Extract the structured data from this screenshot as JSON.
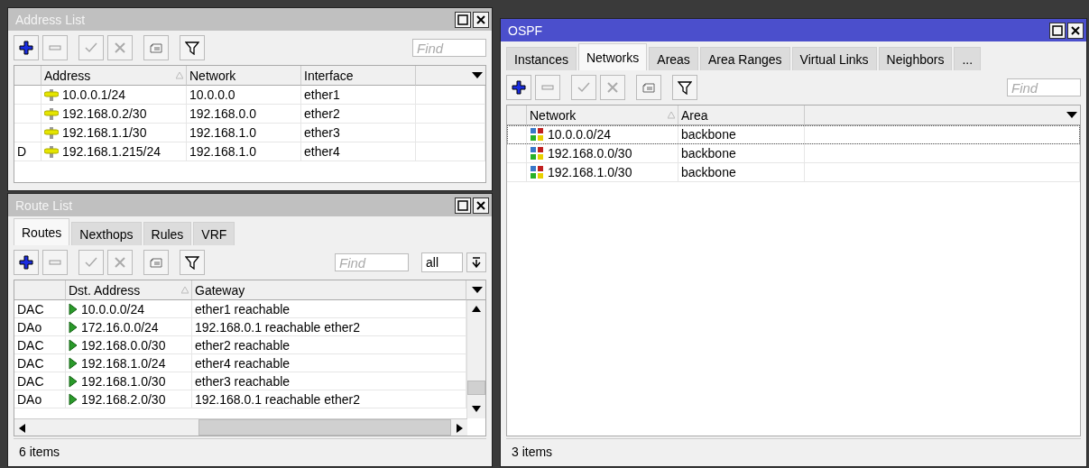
{
  "windows": [
    {
      "kind": "address_list",
      "title": "Address List",
      "active": false,
      "toolbar": {
        "find_placeholder": "Find"
      },
      "table": {
        "columns": [
          {
            "label": "Address",
            "sorted": true
          },
          {
            "label": "Network",
            "sorted": false
          },
          {
            "label": "Interface",
            "sorted": false
          }
        ],
        "rows": [
          {
            "cells": [
              "10.0.0.1/24",
              "10.0.0.0",
              "ether1"
            ]
          },
          {
            "cells": [
              "192.168.0.2/30",
              "192.168.0.0",
              "ether2"
            ]
          },
          {
            "cells": [
              "192.168.1.1/30",
              "192.168.1.0",
              "ether3"
            ]
          },
          {
            "flag": "D",
            "cells": [
              "192.168.1.215/24",
              "192.168.1.0",
              "ether4"
            ]
          }
        ]
      }
    },
    {
      "kind": "route_list",
      "title": "Route List",
      "active": false,
      "tabs": [
        {
          "label": "Routes",
          "selected": true
        },
        {
          "label": "Nexthops",
          "selected": false
        },
        {
          "label": "Rules",
          "selected": false
        },
        {
          "label": "VRF",
          "selected": false
        }
      ],
      "toolbar": {
        "find_placeholder": "Find",
        "filter_value": "all"
      },
      "table": {
        "columns": [
          {
            "label": "Dst. Address",
            "sorted": true
          },
          {
            "label": "Gateway",
            "sorted": false
          }
        ],
        "rows": [
          {
            "flag": "DAC",
            "cells": [
              "10.0.0.0/24",
              "ether1 reachable"
            ]
          },
          {
            "flag": "DAo",
            "cells": [
              "172.16.0.0/24",
              "192.168.0.1 reachable ether2"
            ]
          },
          {
            "flag": "DAC",
            "cells": [
              "192.168.0.0/30",
              "ether2 reachable"
            ]
          },
          {
            "flag": "DAC",
            "cells": [
              "192.168.1.0/24",
              "ether4 reachable"
            ]
          },
          {
            "flag": "DAC",
            "cells": [
              "192.168.1.0/30",
              "ether3 reachable"
            ]
          },
          {
            "flag": "DAo",
            "cells": [
              "192.168.2.0/30",
              "192.168.0.1 reachable ether2"
            ]
          }
        ]
      },
      "status": "6 items"
    },
    {
      "kind": "ospf",
      "title": "OSPF",
      "active": true,
      "tabs": [
        {
          "label": "Instances",
          "selected": false
        },
        {
          "label": "Networks",
          "selected": true
        },
        {
          "label": "Areas",
          "selected": false
        },
        {
          "label": "Area Ranges",
          "selected": false
        },
        {
          "label": "Virtual Links",
          "selected": false
        },
        {
          "label": "Neighbors",
          "selected": false
        },
        {
          "label": "...",
          "selected": false
        }
      ],
      "toolbar": {
        "find_placeholder": "Find"
      },
      "table": {
        "columns": [
          {
            "label": "Network",
            "sorted": true
          },
          {
            "label": "Area",
            "sorted": false
          }
        ],
        "rows": [
          {
            "focused": true,
            "cells": [
              "10.0.0.0/24",
              "backbone"
            ]
          },
          {
            "focused": false,
            "cells": [
              "192.168.0.0/30",
              "backbone"
            ]
          },
          {
            "focused": false,
            "cells": [
              "192.168.1.0/30",
              "backbone"
            ]
          }
        ]
      },
      "status": "3 items"
    }
  ]
}
